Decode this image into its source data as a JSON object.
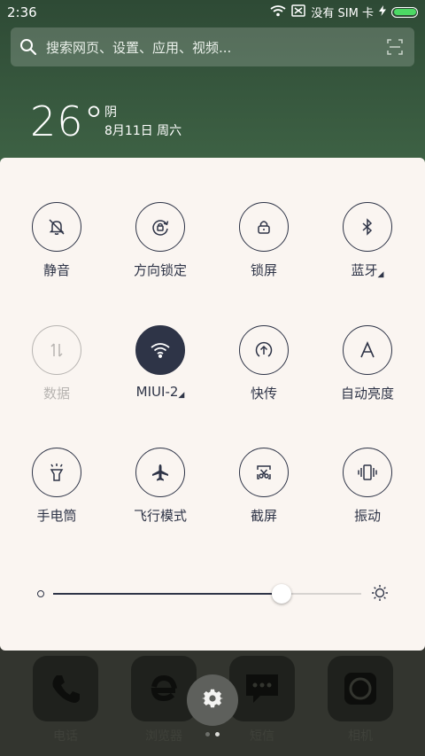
{
  "status_bar": {
    "time": "2:36",
    "carrier": "没有 SIM 卡",
    "battery_level": 1.0,
    "icons": [
      "wifi-icon",
      "no-sim-icon",
      "charging-icon",
      "battery-icon"
    ]
  },
  "search": {
    "placeholder": "搜索网页、设置、应用、视频...",
    "icons": [
      "search-icon",
      "scan-icon"
    ]
  },
  "weather": {
    "temperature": "26°",
    "condition": "阴",
    "date": "8月11日 周六"
  },
  "toggles": [
    {
      "label": "静音",
      "icon": "silent-bell-icon",
      "state": "off"
    },
    {
      "label": "方向锁定",
      "icon": "rotation-lock-icon",
      "state": "off"
    },
    {
      "label": "锁屏",
      "icon": "lock-icon",
      "state": "off"
    },
    {
      "label": "蓝牙",
      "icon": "bluetooth-icon",
      "state": "off",
      "has_more": true
    },
    {
      "label": "数据",
      "icon": "mobile-data-icon",
      "state": "disabled"
    },
    {
      "label": "MIUI-2",
      "icon": "wifi-icon",
      "state": "on",
      "has_more": true
    },
    {
      "label": "快传",
      "icon": "quick-transfer-icon",
      "state": "off"
    },
    {
      "label": "自动亮度",
      "icon": "auto-brightness-icon",
      "state": "off"
    },
    {
      "label": "手电筒",
      "icon": "flashlight-icon",
      "state": "off"
    },
    {
      "label": "飞行模式",
      "icon": "airplane-icon",
      "state": "off"
    },
    {
      "label": "截屏",
      "icon": "screenshot-icon",
      "state": "off"
    },
    {
      "label": "振动",
      "icon": "vibrate-icon",
      "state": "off"
    }
  ],
  "brightness": {
    "level": 0.74,
    "icons": [
      "brightness-low-icon",
      "brightness-high-icon"
    ]
  },
  "dock": [
    {
      "label": "电话",
      "icon": "phone-icon"
    },
    {
      "label": "浏览器",
      "icon": "browser-icon"
    },
    {
      "label": "短信",
      "icon": "sms-icon"
    },
    {
      "label": "相机",
      "icon": "camera-icon"
    }
  ],
  "settings": {
    "icon": "gear-icon"
  },
  "pager": {
    "count": 2,
    "active": 1
  },
  "colors": {
    "panel_bg": "#faf5f1",
    "accent": "#2e3447",
    "disabled": "#b7b4b1",
    "wallpaper": "#3f6446",
    "battery": "#4cd964"
  }
}
